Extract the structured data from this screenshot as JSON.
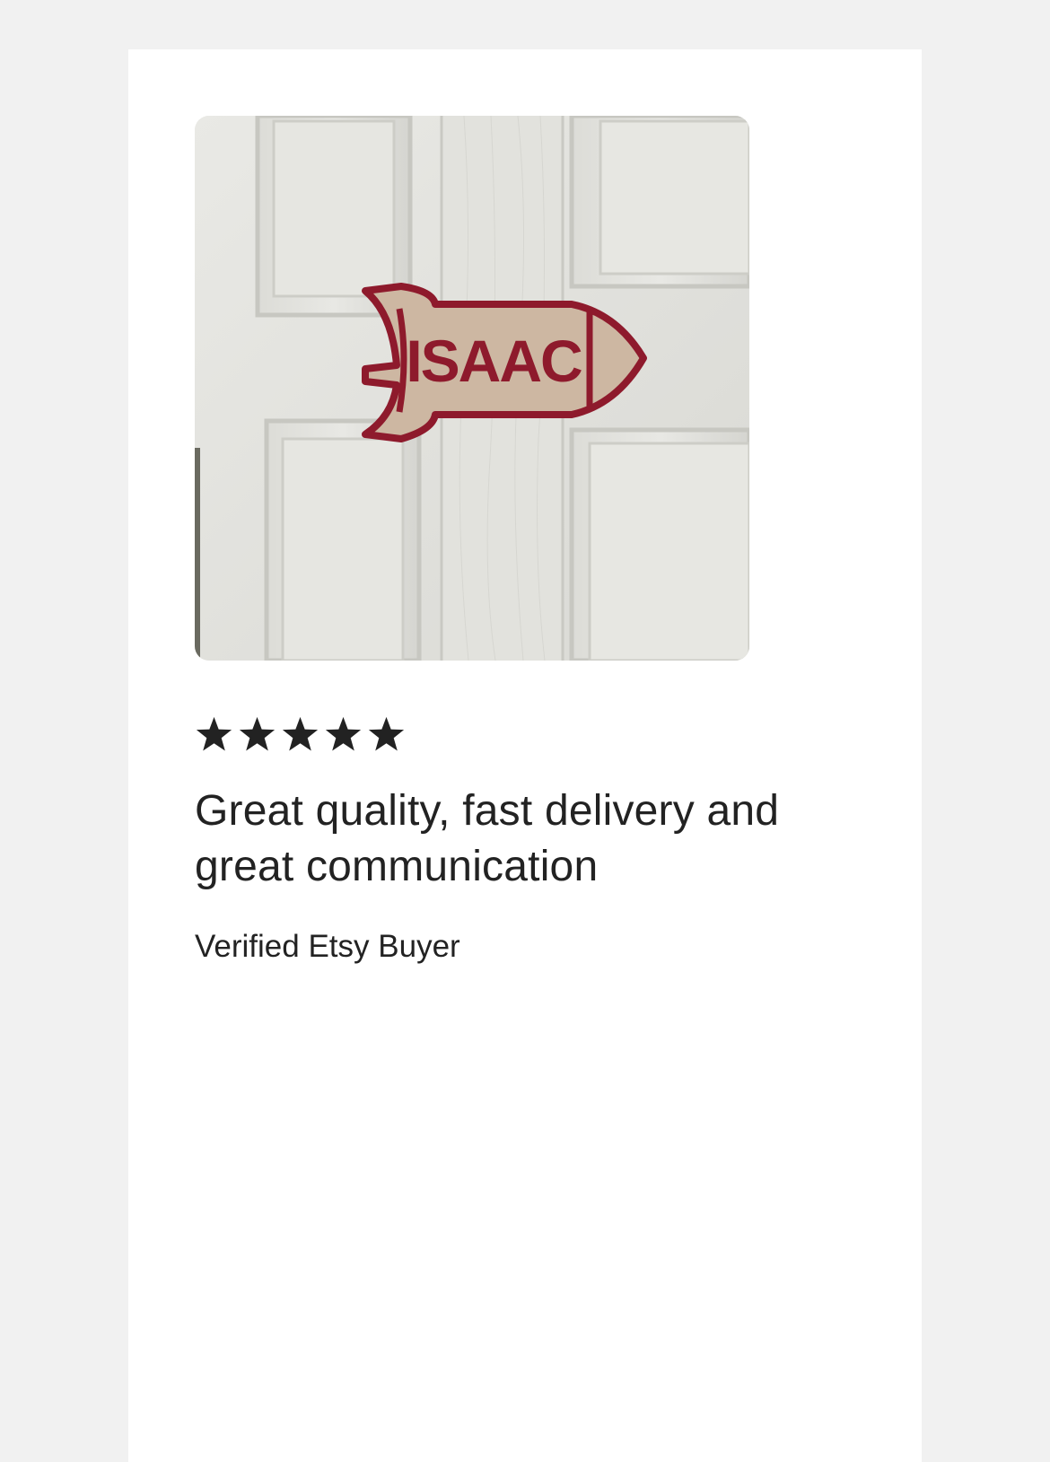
{
  "review": {
    "photo": {
      "sign_text": "ISAAC",
      "colors": {
        "door": "#e4e4df",
        "door_shadow": "#cfcfca",
        "sign_outline": "#8e1a2c",
        "sign_wood": "#cdb7a2"
      }
    },
    "rating": {
      "value": 5,
      "max": 5,
      "icon": "star-icon",
      "color": "#222222"
    },
    "title": "Great quality, fast delivery and great communication",
    "reviewer": "Verified Etsy Buyer"
  }
}
